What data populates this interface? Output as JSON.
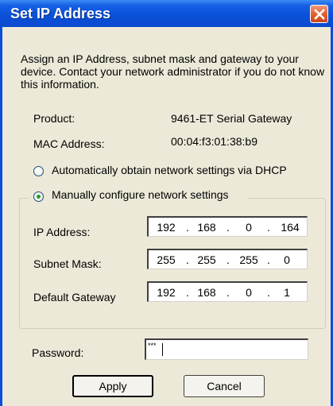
{
  "window": {
    "title": "Set IP Address",
    "close_icon": "close-icon"
  },
  "intro_text": "Assign an IP Address, subnet mask and gateway to your device.  Contact your network administrator if you do not know this information.",
  "product": {
    "label": "Product:",
    "value": "9461-ET Serial Gateway"
  },
  "mac": {
    "label": "MAC Address:",
    "value": "00:04:f3:01:38:b9"
  },
  "dhcp_option": {
    "label": "Automatically obtain network settings via DHCP",
    "selected": false
  },
  "manual_option": {
    "label": "Manually configure network settings",
    "selected": true
  },
  "ip_address": {
    "label": "IP Address:",
    "octets": [
      "192",
      "168",
      "0",
      "164"
    ]
  },
  "subnet_mask": {
    "label": "Subnet Mask:",
    "octets": [
      "255",
      "255",
      "255",
      "0"
    ]
  },
  "default_gateway": {
    "label": "Default Gateway",
    "octets": [
      "192",
      "168",
      "0",
      "1"
    ]
  },
  "password": {
    "label": "Password:",
    "value": "***"
  },
  "buttons": {
    "apply": "Apply",
    "cancel": "Cancel"
  },
  "colors": {
    "titlebar": "#0a4fd7",
    "dialog_bg": "#ece9d8",
    "radio_dot": "#21a121",
    "close_button": "#e2622e"
  }
}
